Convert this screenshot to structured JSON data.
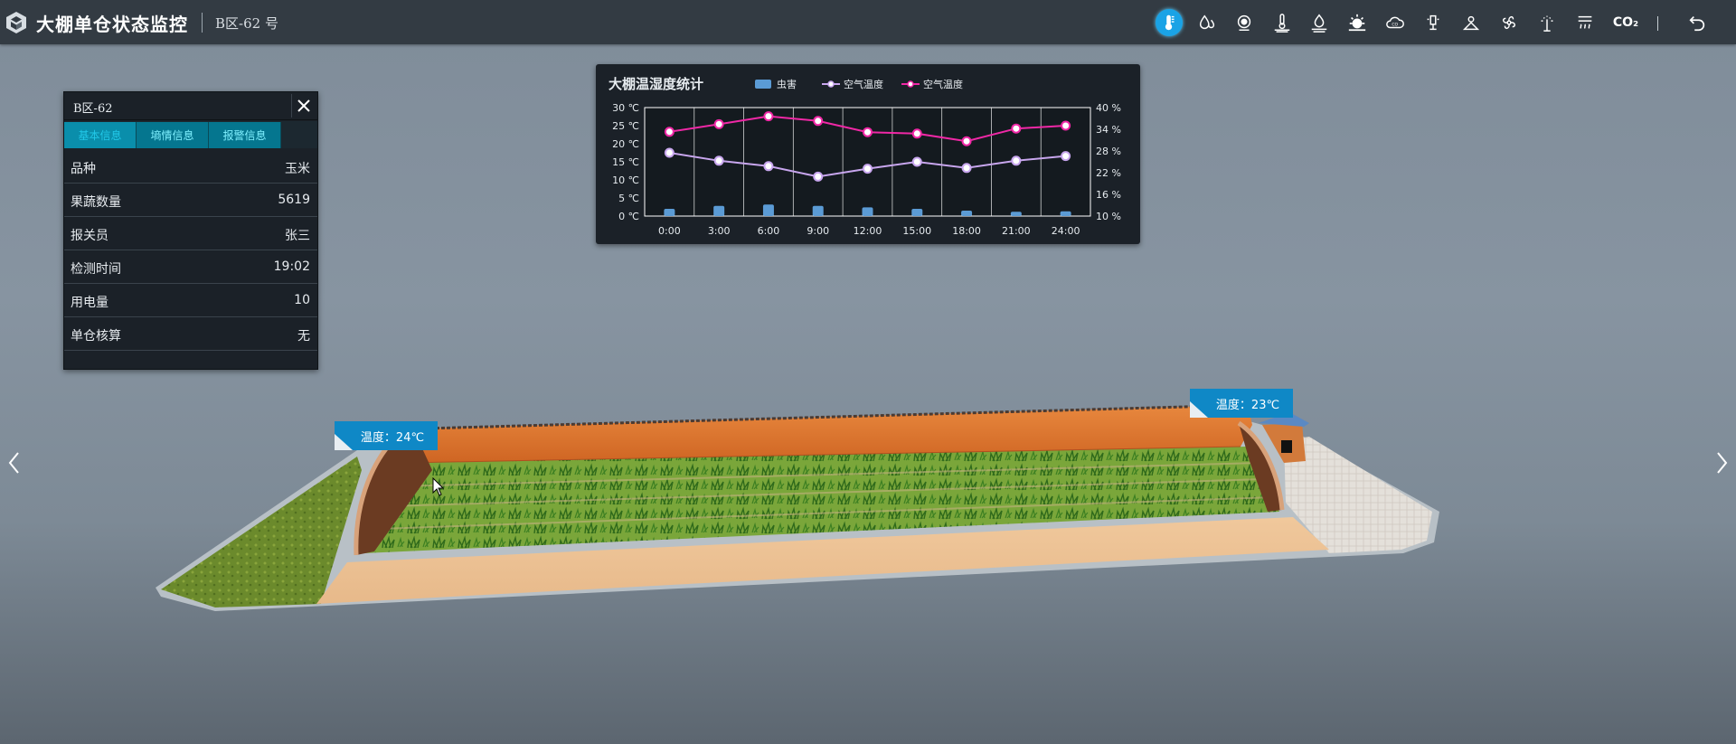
{
  "header": {
    "title": "大棚单仓状态监控",
    "subtitle": "B区-62 号"
  },
  "toolbar": {
    "tools": [
      {
        "name": "thermometer-icon",
        "active": true
      },
      {
        "name": "water-drops-icon"
      },
      {
        "name": "sensor-icon"
      },
      {
        "name": "soil-temperature-icon"
      },
      {
        "name": "soil-moisture-icon"
      },
      {
        "name": "sunlight-icon"
      },
      {
        "name": "cloud-co-icon"
      },
      {
        "name": "pest-light-icon"
      },
      {
        "name": "light-intensity-icon"
      },
      {
        "name": "fan-icon"
      },
      {
        "name": "sprinkler-icon"
      },
      {
        "name": "heater-icon"
      }
    ],
    "co2_label": "CO₂"
  },
  "panel": {
    "title": "B区-62",
    "tabs": [
      "基本信息",
      "墒情信息",
      "报警信息"
    ],
    "rows": [
      {
        "key": "品种",
        "value": "玉米"
      },
      {
        "key": "果蔬数量",
        "value": "5619"
      },
      {
        "key": "报关员",
        "value": "张三"
      },
      {
        "key": "检测时间",
        "value": "19:02"
      },
      {
        "key": "用电量",
        "value": "10"
      },
      {
        "key": "单仓核算",
        "value": "无"
      }
    ]
  },
  "chart_data": {
    "type": "bar",
    "title": "大棚温湿度统计",
    "categories": [
      "0:00",
      "3:00",
      "6:00",
      "9:00",
      "12:00",
      "15:00",
      "18:00",
      "21:00",
      "24:00"
    ],
    "y_left_ticks": [
      "30 ℃",
      "25 ℃",
      "20 ℃",
      "15 ℃",
      "10 ℃",
      "5 ℃",
      "0 ℃"
    ],
    "y_right_ticks": [
      "40 %",
      "34 %",
      "28 %",
      "22 %",
      "16 %",
      "10 %"
    ],
    "ylim_left": [
      0,
      30
    ],
    "grid": true,
    "legend_position": "top",
    "series": [
      {
        "name": "虫害",
        "type": "bar",
        "color": "#5b9bd5",
        "values": [
          2,
          2.8,
          3.2,
          2.8,
          2.4,
          2,
          1.5,
          1.2,
          1.3
        ]
      },
      {
        "name": "空气温度",
        "type": "line",
        "color": "#c8a6ee",
        "values": [
          17.5,
          15.3,
          13.8,
          10.9,
          13.1,
          15,
          13.3,
          15.3,
          16.6
        ]
      },
      {
        "name": "空气温度",
        "type": "line",
        "color": "#f028a6",
        "values": [
          23.3,
          25.4,
          27.6,
          26.3,
          23.2,
          22.8,
          20.7,
          24.2,
          25
        ]
      }
    ]
  },
  "scene": {
    "tags": [
      {
        "label": "温度：24℃"
      },
      {
        "label": "温度：23℃"
      }
    ]
  }
}
